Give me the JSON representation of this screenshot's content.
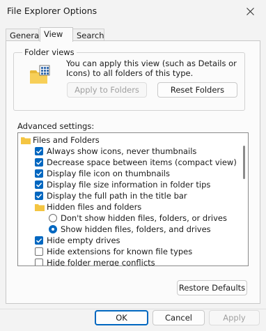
{
  "window": {
    "title": "File Explorer Options"
  },
  "tabs": [
    {
      "label": "General",
      "active": false
    },
    {
      "label": "View",
      "active": true
    },
    {
      "label": "Search",
      "active": false
    }
  ],
  "folder_views": {
    "label": "Folder views",
    "description": "You can apply this view (such as Details or Icons) to all folders of this type.",
    "apply_label": "Apply to Folders",
    "reset_label": "Reset Folders"
  },
  "advanced": {
    "label": "Advanced settings:",
    "items": [
      {
        "type": "folder",
        "label": "Files and Folders"
      },
      {
        "type": "checkbox",
        "label": "Always show icons, never thumbnails",
        "checked": true
      },
      {
        "type": "checkbox",
        "label": "Decrease space between items (compact view)",
        "checked": true
      },
      {
        "type": "checkbox",
        "label": "Display file icon on thumbnails",
        "checked": true
      },
      {
        "type": "checkbox",
        "label": "Display file size information in folder tips",
        "checked": true
      },
      {
        "type": "checkbox",
        "label": "Display the full path in the title bar",
        "checked": true
      },
      {
        "type": "folder",
        "label": "Hidden files and folders"
      },
      {
        "type": "radio",
        "label": "Don't show hidden files, folders, or drives",
        "checked": false
      },
      {
        "type": "radio",
        "label": "Show hidden files, folders, and drives",
        "checked": true
      },
      {
        "type": "checkbox",
        "label": "Hide empty drives",
        "checked": true
      },
      {
        "type": "checkbox",
        "label": "Hide extensions for known file types",
        "checked": false
      },
      {
        "type": "checkbox",
        "label": "Hide folder merge conflicts",
        "checked": false
      }
    ],
    "restore_label": "Restore Defaults"
  },
  "footer": {
    "ok_label": "OK",
    "cancel_label": "Cancel",
    "apply_label": "Apply"
  },
  "colors": {
    "accent": "#0067c0",
    "folder": "#f4c542"
  }
}
